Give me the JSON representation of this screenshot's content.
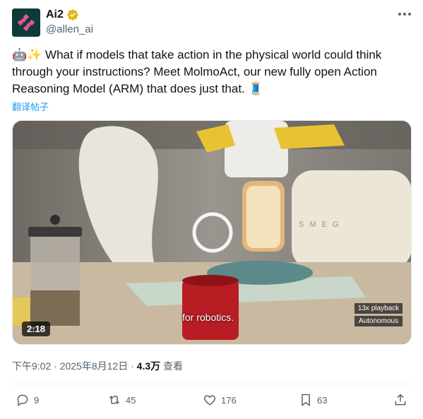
{
  "author": {
    "display_name": "Ai2",
    "handle": "@allen_ai",
    "verified_icon": "verified-badge-icon",
    "avatar_color": "#0c3b3a",
    "logo_color": "#f0529c"
  },
  "tweet": {
    "text_line1": "🤖✨ What if models that take action in the physical world could think",
    "text_line2": "through your instructions? Meet MolmoAct, our new fully open Action",
    "text_line3": "Reasoning Model (ARM) that does just that. 🧵",
    "translate_label": "翻译帖子"
  },
  "video": {
    "duration": "2:18",
    "caption": "for robotics.",
    "overlay_line1": "13x playback",
    "overlay_line2": "Autonomous"
  },
  "meta": {
    "time": "下午9:02",
    "separator": " · ",
    "date": "2025年8月12日",
    "views_count": "4.3万",
    "views_label": " 查看"
  },
  "actions": {
    "replies": "9",
    "reposts": "45",
    "likes": "176",
    "bookmarks": "63"
  },
  "colors": {
    "text_primary": "#0f1419",
    "text_secondary": "#536471",
    "link": "#1d9bf0",
    "badge_gold": "#e2b719"
  }
}
